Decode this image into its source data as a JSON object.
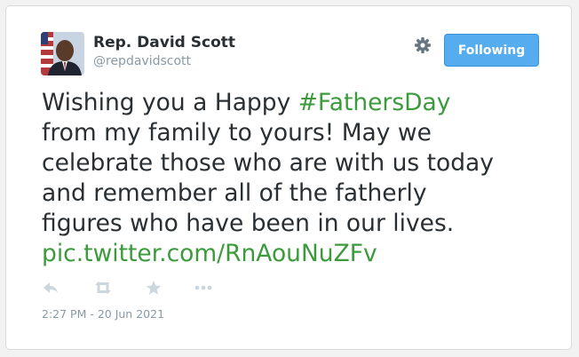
{
  "user": {
    "display_name": "Rep. David Scott",
    "handle": "@repdavidscott"
  },
  "follow_button": {
    "label": "Following"
  },
  "tweet": {
    "text_before_hashtag": "Wishing you a Happy ",
    "hashtag": "#FathersDay",
    "line2": "from my family to yours! May we",
    "line3": "celebrate those who are with us today",
    "line4": "and remember all of the fatherly",
    "line5": "figures who have been in our lives.",
    "link": "pic.twitter.com/RnAouNuZFv"
  },
  "actions": {
    "icons": [
      "reply-icon",
      "retweet-icon",
      "favorite-icon",
      "more-icon"
    ]
  },
  "timestamp": "2:27 PM - 20 Jun 2021",
  "colors": {
    "link_green": "#3b9a3b",
    "button_blue": "#55acee",
    "text_dark": "#292f33",
    "text_muted": "#8899a6",
    "icon_gray": "#ccd6dd"
  }
}
